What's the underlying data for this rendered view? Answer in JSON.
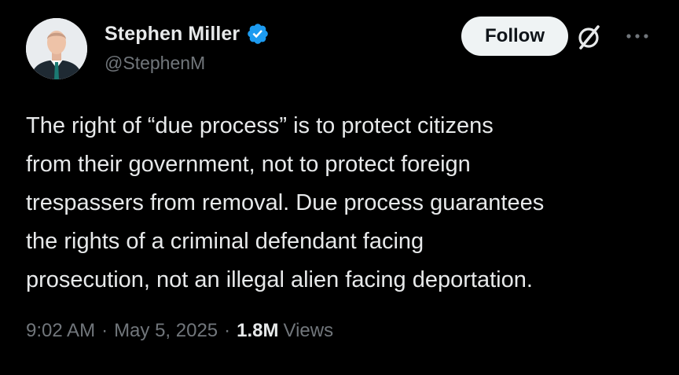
{
  "author": {
    "display_name": "Stephen Miller",
    "handle": "@StephenM",
    "verified": true,
    "avatar_icon": "profile-photo"
  },
  "actions": {
    "follow_label": "Follow",
    "grok_icon": "grok-slash-icon",
    "more_icon": "more-horizontal-icon"
  },
  "tweet": {
    "text": "The right of “due process” is to protect citizens\nfrom their government, not to protect foreign\ntrespassers from removal. Due process guarantees\nthe rights of a criminal defendant facing\nprosecution, not an illegal alien facing deportation."
  },
  "meta": {
    "time": "9:02 AM",
    "separator": "·",
    "date": "May 5, 2025",
    "views_count": "1.8M",
    "views_label": "Views"
  },
  "colors": {
    "background": "#000000",
    "primary_text": "#e7e9ea",
    "secondary_text": "#71767b",
    "verified_badge": "#1d9bf0",
    "follow_button_bg": "#eff3f4"
  }
}
